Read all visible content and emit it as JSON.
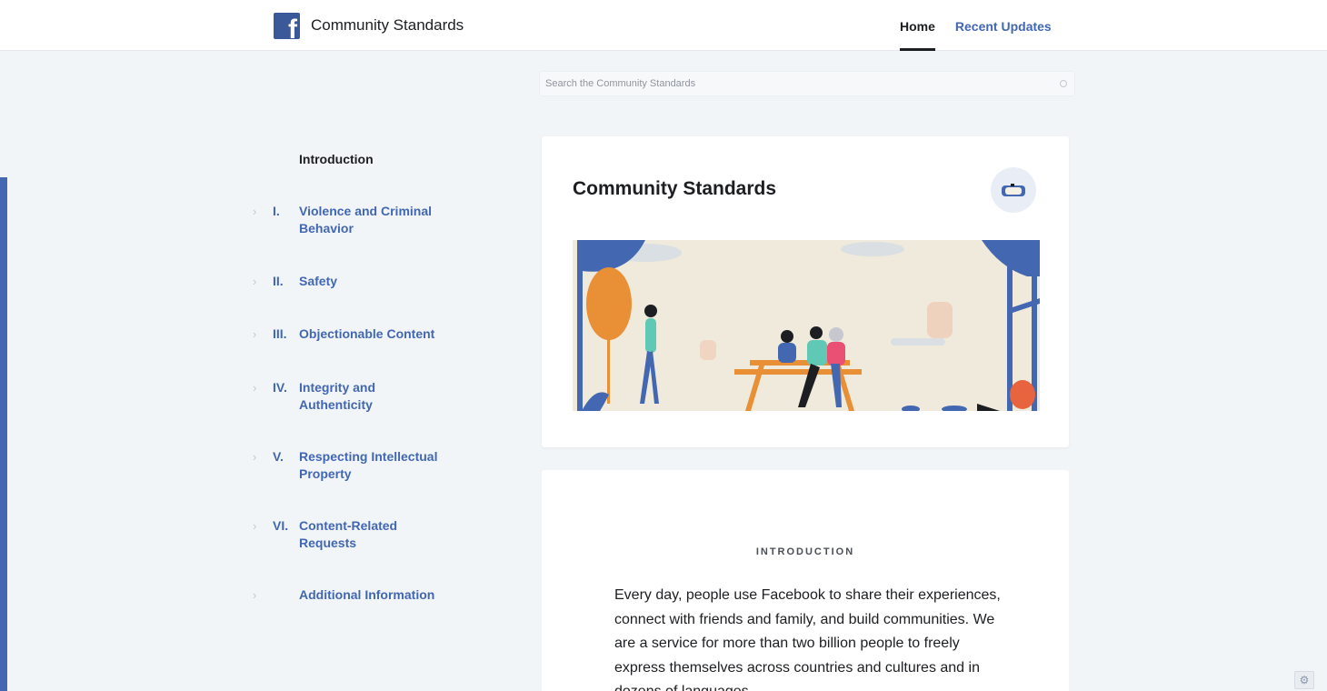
{
  "header": {
    "brand_title": "Community Standards",
    "nav": [
      {
        "label": "Home",
        "active": true
      },
      {
        "label": "Recent Updates",
        "active": false
      }
    ]
  },
  "search": {
    "placeholder": "Search the Community Standards"
  },
  "sidebar": {
    "intro_label": "Introduction",
    "items": [
      {
        "num": "I.",
        "label": "Violence and Criminal Behavior"
      },
      {
        "num": "II.",
        "label": "Safety"
      },
      {
        "num": "III.",
        "label": "Objectionable Content"
      },
      {
        "num": "IV.",
        "label": "Integrity and Authenticity"
      },
      {
        "num": "V.",
        "label": "Respecting Intellectual Property"
      },
      {
        "num": "VI.",
        "label": "Content-Related Requests"
      },
      {
        "num": "",
        "label": "Additional Information"
      }
    ]
  },
  "main": {
    "card_title": "Community Standards",
    "intro_heading": "INTRODUCTION",
    "intro_text": "Every day, people use Facebook to share their experiences, connect with friends and family, and build communities. We are a service for more than two billion people to freely express themselves across countries and cultures and in dozens of languages."
  },
  "colors": {
    "accent": "#4267b2",
    "brand": "#3b5998",
    "page_background": "#f2f5f8"
  },
  "icons": {
    "brand": "facebook-logo-icon",
    "chevron": "chevron-right-icon",
    "search": "search-icon",
    "corner": "settings-icon"
  }
}
